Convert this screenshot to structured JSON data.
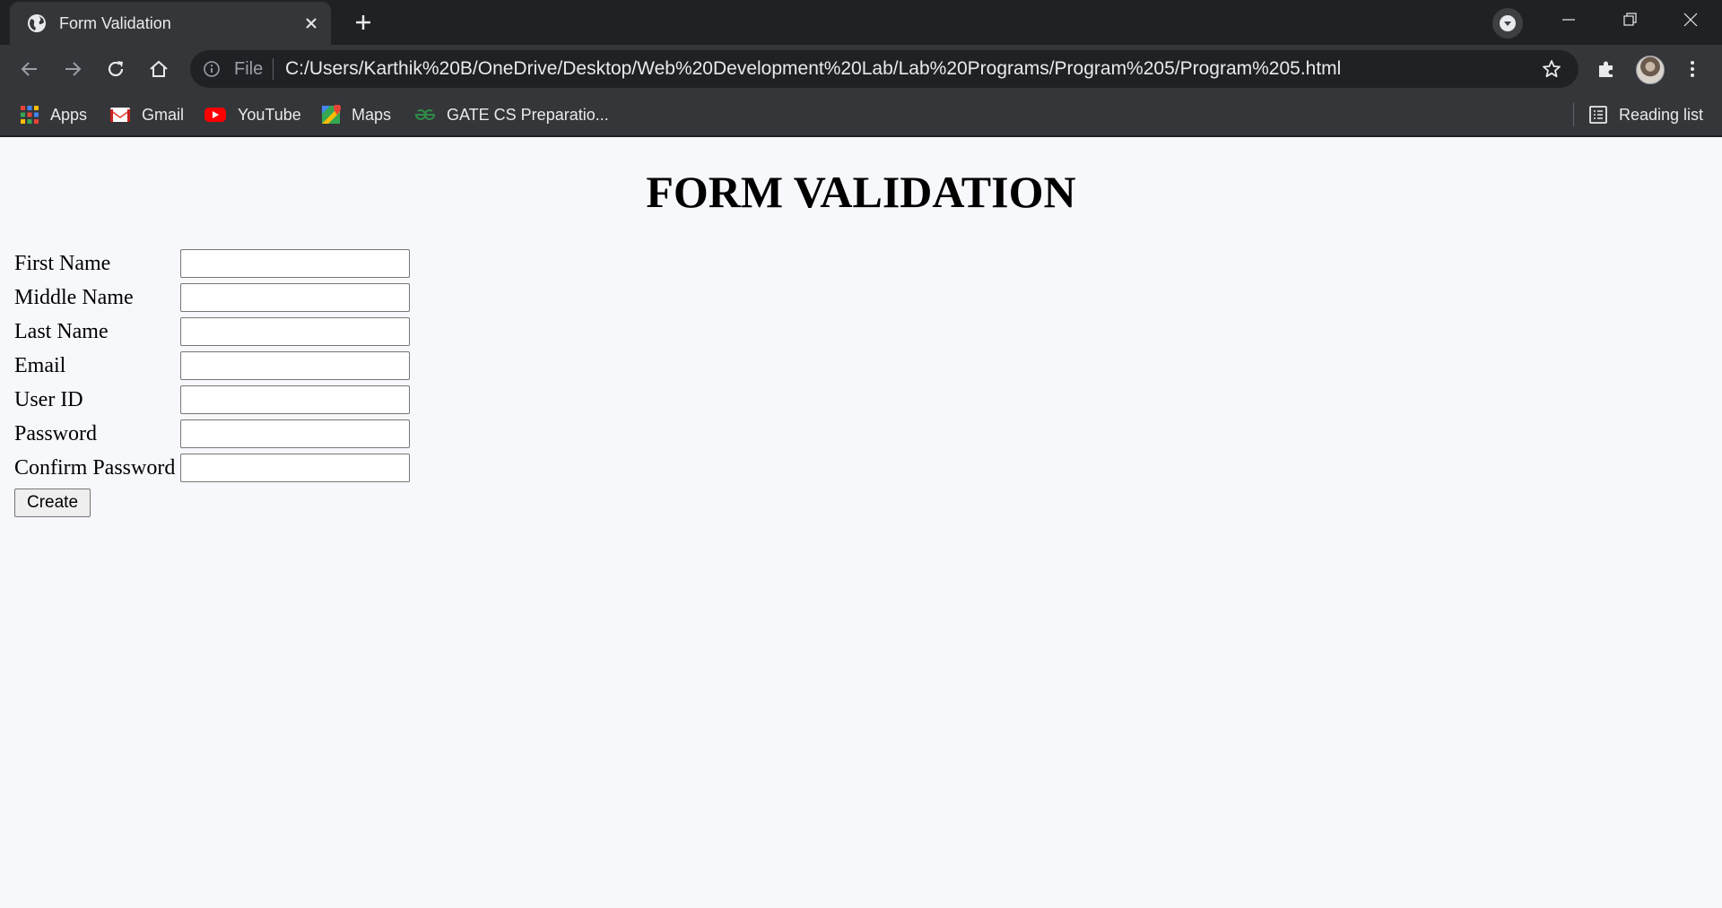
{
  "browser": {
    "tab_title": "Form Validation",
    "address_scheme": "File",
    "url": "C:/Users/Karthik%20B/OneDrive/Desktop/Web%20Development%20Lab/Lab%20Programs/Program%205/Program%205.html",
    "bookmarks": [
      {
        "label": "Apps",
        "icon": "apps-grid-icon"
      },
      {
        "label": "Gmail",
        "icon": "gmail-icon"
      },
      {
        "label": "YouTube",
        "icon": "youtube-icon"
      },
      {
        "label": "Maps",
        "icon": "maps-icon"
      },
      {
        "label": "GATE CS Preparatio...",
        "icon": "geeksforgeeks-icon"
      }
    ],
    "reading_list_label": "Reading list",
    "colors": {
      "frame": "#202124",
      "toolbar": "#35363a",
      "text": "#e8eaed"
    }
  },
  "page": {
    "heading": "FORM VALIDATION",
    "fields": [
      {
        "label": "First Name",
        "value": ""
      },
      {
        "label": "Middle Name",
        "value": ""
      },
      {
        "label": "Last Name",
        "value": ""
      },
      {
        "label": "Email",
        "value": ""
      },
      {
        "label": "User ID",
        "value": ""
      },
      {
        "label": "Password",
        "value": ""
      },
      {
        "label": "Confirm Password",
        "value": ""
      }
    ],
    "submit_label": "Create",
    "background": "#f7f8fc"
  }
}
